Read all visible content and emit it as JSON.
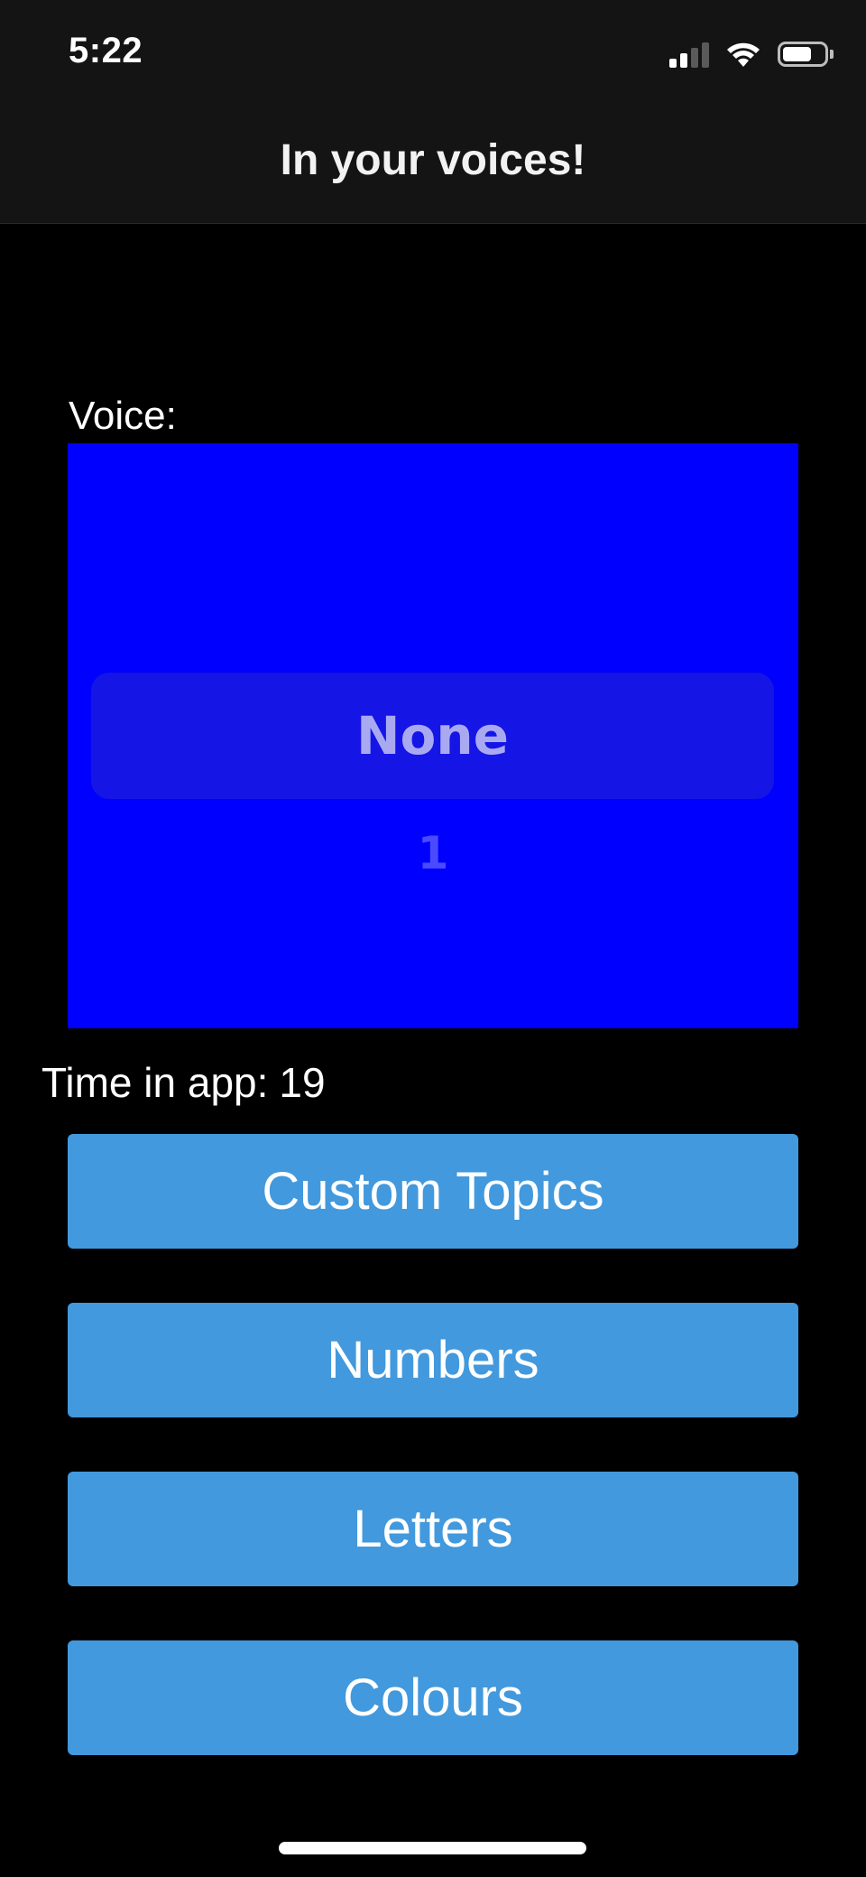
{
  "status_bar": {
    "time": "5:22",
    "icons": [
      "cellular-signal-icon",
      "wifi-icon",
      "battery-icon"
    ]
  },
  "nav": {
    "title": "In your voices!"
  },
  "voice": {
    "label": "Voice:",
    "selected": "None",
    "next_option": "1"
  },
  "time_in_app": {
    "label": "Time in app:",
    "value": "19"
  },
  "buttons": [
    {
      "label": "Custom Topics"
    },
    {
      "label": "Numbers"
    },
    {
      "label": "Letters"
    },
    {
      "label": "Colours"
    }
  ],
  "colors": {
    "background": "#000000",
    "header": "#141414",
    "picker": "#0000fe",
    "button": "#4299dd"
  }
}
